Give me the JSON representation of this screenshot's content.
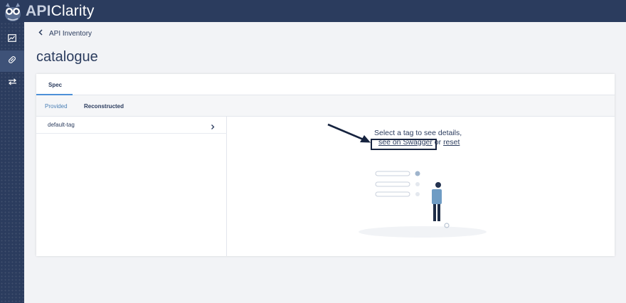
{
  "app": {
    "logo_prefix": "API",
    "logo_suffix": "Clarity"
  },
  "sidebar": {
    "items": [
      {
        "icon": "dashboard-icon",
        "active": false
      },
      {
        "icon": "api-inventory-icon",
        "active": true
      },
      {
        "icon": "api-events-icon",
        "active": false
      }
    ]
  },
  "breadcrumb": {
    "back_label": "API Inventory"
  },
  "page": {
    "title": "catalogue"
  },
  "tabs": [
    {
      "label": "Spec",
      "active": true
    }
  ],
  "subtabs": [
    {
      "label": "Provided",
      "active": false
    },
    {
      "label": "Reconstructed",
      "active": true
    }
  ],
  "tags": [
    {
      "label": "default-tag"
    }
  ],
  "empty_state": {
    "line1": "Select a tag to see details,",
    "swagger_link": "see on Swagger",
    "or_text": " or ",
    "reset_link": "reset"
  },
  "colors": {
    "nav_bg": "#2b3c5e",
    "accent": "#4d90d8",
    "highlight_box": "#16233f"
  }
}
